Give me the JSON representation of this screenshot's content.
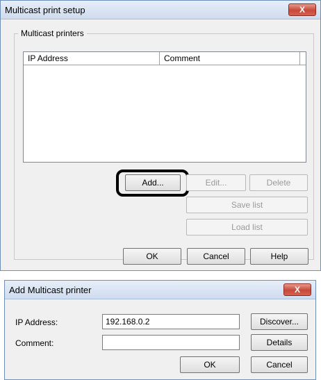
{
  "setup_dialog": {
    "title": "Multicast print setup",
    "close_label": "X",
    "group_label": "Multicast printers",
    "columns": [
      "IP Address",
      "Comment"
    ],
    "buttons": {
      "add": "Add...",
      "edit": "Edit...",
      "delete": "Delete",
      "save_list": "Save list",
      "load_list": "Load list",
      "ok": "OK",
      "cancel": "Cancel",
      "help": "Help"
    }
  },
  "add_dialog": {
    "title": "Add Multicast printer",
    "close_label": "X",
    "ip_label": "IP Address:",
    "ip_value": "192.168.0.2",
    "comment_label": "Comment:",
    "comment_value": "",
    "buttons": {
      "discover": "Discover...",
      "details": "Details",
      "ok": "OK",
      "cancel": "Cancel"
    }
  },
  "colors": {
    "close_button": "#c6493a",
    "highlight_ring": "#000000"
  }
}
